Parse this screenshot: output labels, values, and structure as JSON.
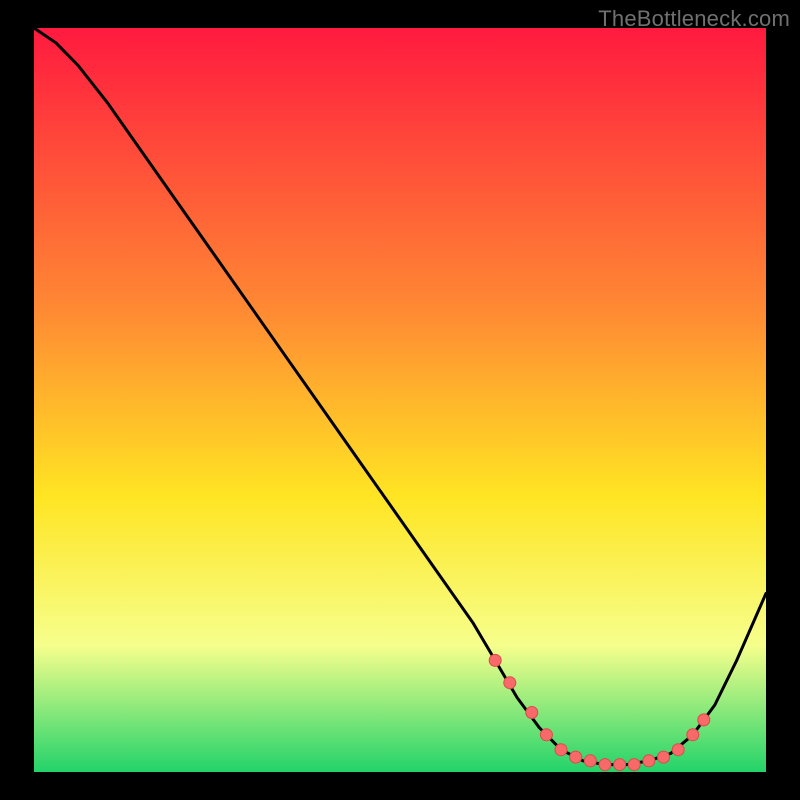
{
  "attribution": "TheBottleneck.com",
  "colors": {
    "top": "#ff1a3f",
    "mid1": "#ff8a33",
    "mid2": "#ffe523",
    "mid3": "#f6ff8c",
    "bottom": "#22d36a",
    "curve": "#000000",
    "marker_fill": "#f86a6a",
    "marker_stroke": "#dc4a4a",
    "frame": "#000000"
  },
  "chart_data": {
    "type": "line",
    "title": "",
    "xlabel": "",
    "ylabel": "",
    "xlim": [
      0,
      100
    ],
    "ylim": [
      0,
      100
    ],
    "series": [
      {
        "name": "bottleneck-curve",
        "x": [
          0,
          3,
          6,
          10,
          15,
          20,
          25,
          30,
          35,
          40,
          45,
          50,
          55,
          60,
          63,
          66,
          69,
          72,
          75,
          78,
          81,
          84,
          87,
          90,
          93,
          96,
          100
        ],
        "y": [
          100,
          98,
          95,
          90,
          83,
          76,
          69,
          62,
          55,
          48,
          41,
          34,
          27,
          20,
          15,
          10,
          6,
          3,
          1.5,
          1,
          1,
          1.5,
          2.5,
          5,
          9,
          15,
          24
        ]
      }
    ],
    "markers": {
      "name": "optimal-points",
      "x": [
        63,
        65,
        68,
        70,
        72,
        74,
        76,
        78,
        80,
        82,
        84,
        86,
        88,
        90,
        91.5
      ],
      "y": [
        15,
        12,
        8,
        5,
        3,
        2,
        1.5,
        1,
        1,
        1,
        1.5,
        2,
        3,
        5,
        7
      ]
    }
  }
}
